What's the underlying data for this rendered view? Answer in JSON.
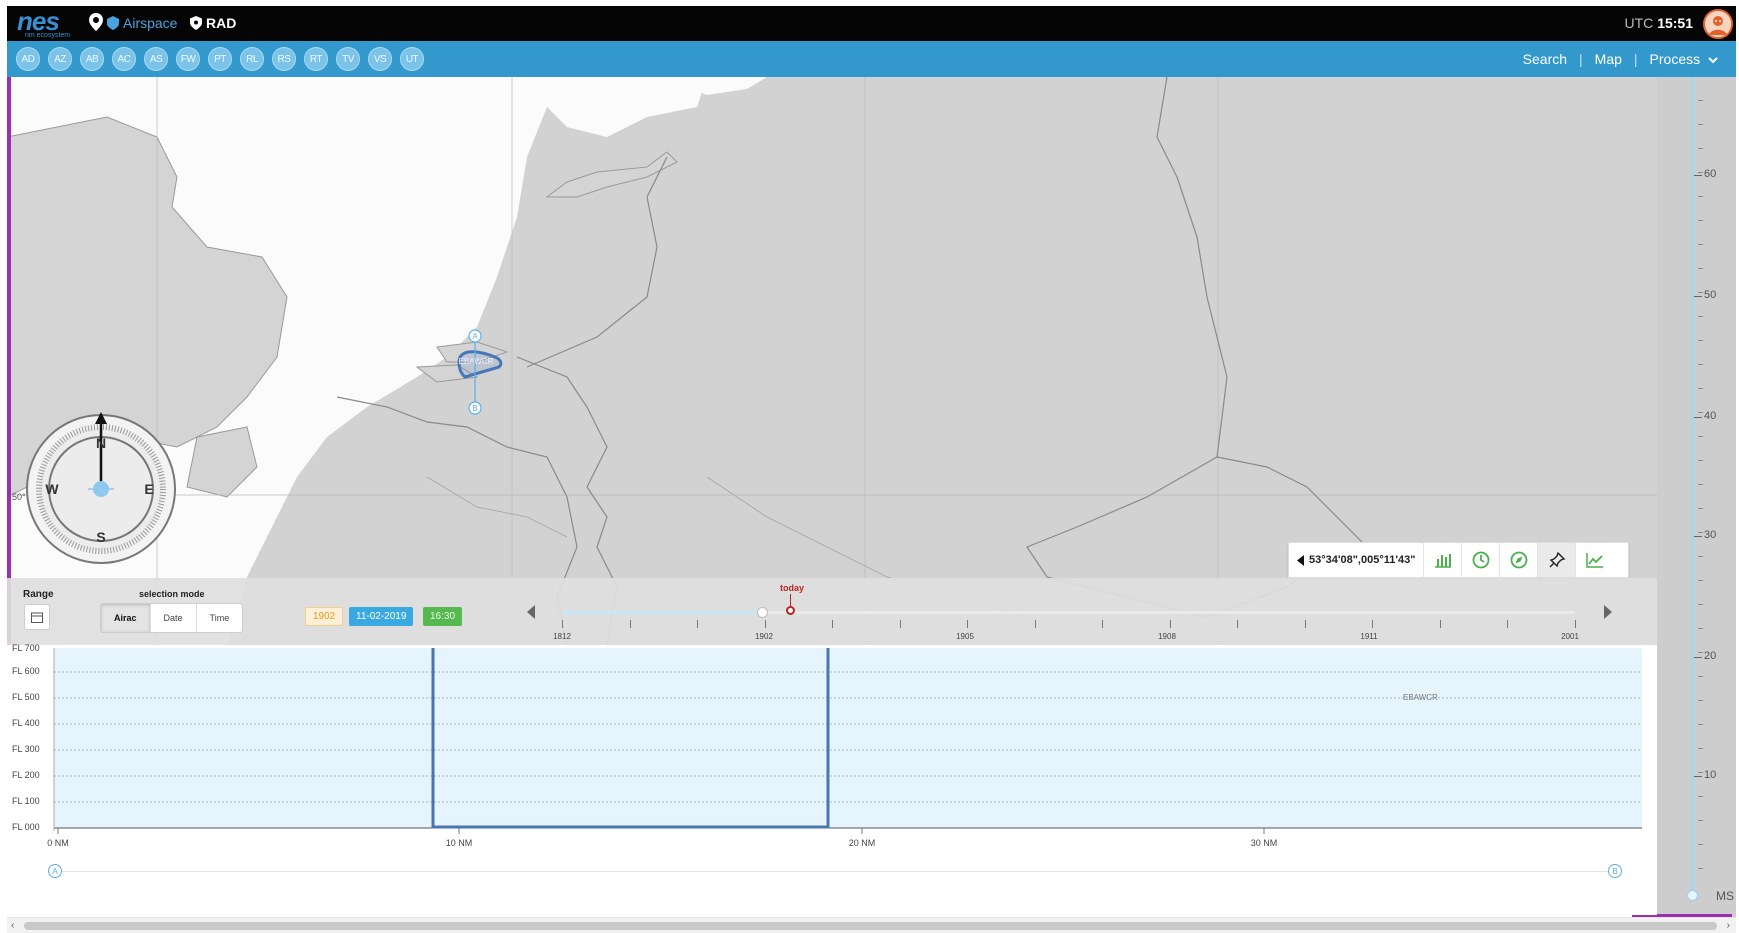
{
  "app": {
    "logo_text": "nes",
    "logo_sub": "nm ecosystem",
    "app_links": [
      "Airspace",
      "RAD"
    ],
    "utc_label": "UTC",
    "utc_time": "15:51"
  },
  "badges": [
    "AD",
    "AZ",
    "AB",
    "AC",
    "AS",
    "FW",
    "PT",
    "RL",
    "RS",
    "RT",
    "TV",
    "VS",
    "UT"
  ],
  "nav": {
    "search": "Search",
    "map": "Map",
    "process": "Process"
  },
  "map": {
    "airspace_label": "EBAWCR",
    "point_a": "A",
    "point_b": "B",
    "lat_label": "50°"
  },
  "compass": {
    "north": "N",
    "south": "S",
    "east": "E",
    "west": "W"
  },
  "coord_toolbar": {
    "coordinates": "53°34'08\",005°11'43\"",
    "tools": [
      "bar-chart-icon",
      "clock-icon",
      "compass-icon",
      "pin-icon",
      "line-chart-icon"
    ]
  },
  "timeline": {
    "range_label": "Range",
    "selection_mode_label": "selection mode",
    "modes": [
      "Airac",
      "Date",
      "Time"
    ],
    "active_mode": "Airac",
    "chip_year": "1902",
    "chip_date": "11-02-2019",
    "chip_time": "16:30",
    "today_label": "today",
    "labels": [
      "1812",
      "1902",
      "1905",
      "1908",
      "1911",
      "2001"
    ]
  },
  "altitude_scale": {
    "ticks": [
      "60",
      "50",
      "40",
      "30",
      "20",
      "10"
    ],
    "bottom_label": "MS"
  },
  "profile": {
    "fl_labels": [
      "FL 700",
      "FL 600",
      "FL 500",
      "FL 400",
      "FL 300",
      "FL 200",
      "FL 100",
      "FL 000"
    ],
    "nm_labels": [
      "0 NM",
      "10 NM",
      "20 NM",
      "30 NM"
    ],
    "airspace_label": "EBAWCR",
    "start_marker": "A",
    "end_marker": "B"
  }
}
